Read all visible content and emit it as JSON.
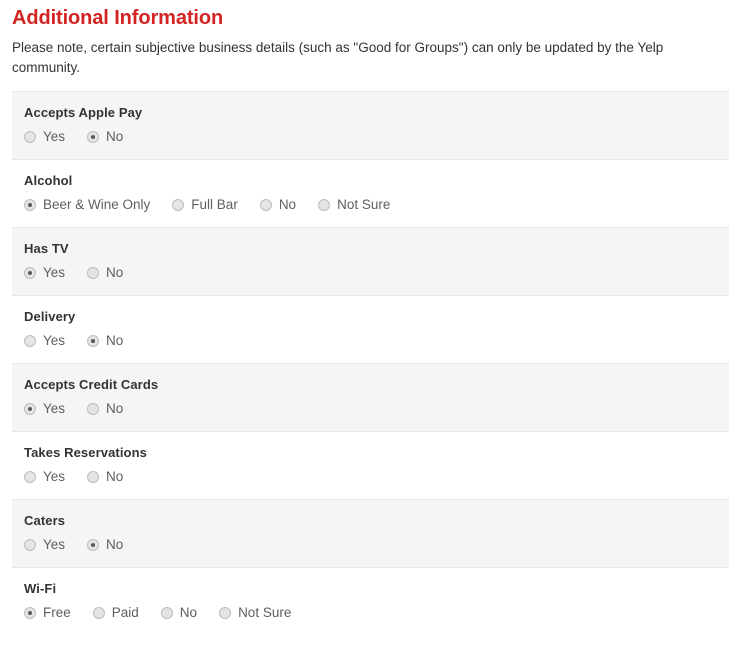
{
  "header": {
    "title": "Additional Information",
    "note": "Please note, certain subjective business details (such as \"Good for Groups\") can only be updated by the Yelp community."
  },
  "colors": {
    "title_red": "#d32323",
    "row_shaded": "#f5f5f5",
    "row_plain": "#ffffff",
    "divider": "#e6e6e6",
    "label_text": "#333333",
    "option_text": "#5f5f5f",
    "radio_fill": "#e4e4e4",
    "radio_dot": "#5a5a5a"
  },
  "attributes": [
    {
      "label": "Accepts Apple Pay",
      "shaded": true,
      "options": [
        {
          "label": "Yes",
          "selected": false
        },
        {
          "label": "No",
          "selected": true
        }
      ]
    },
    {
      "label": "Alcohol",
      "shaded": false,
      "options": [
        {
          "label": "Beer & Wine Only",
          "selected": true
        },
        {
          "label": "Full Bar",
          "selected": false
        },
        {
          "label": "No",
          "selected": false
        },
        {
          "label": "Not Sure",
          "selected": false
        }
      ]
    },
    {
      "label": "Has TV",
      "shaded": true,
      "options": [
        {
          "label": "Yes",
          "selected": true
        },
        {
          "label": "No",
          "selected": false
        }
      ]
    },
    {
      "label": "Delivery",
      "shaded": false,
      "options": [
        {
          "label": "Yes",
          "selected": false
        },
        {
          "label": "No",
          "selected": true
        }
      ]
    },
    {
      "label": "Accepts Credit Cards",
      "shaded": true,
      "options": [
        {
          "label": "Yes",
          "selected": true
        },
        {
          "label": "No",
          "selected": false
        }
      ]
    },
    {
      "label": "Takes Reservations",
      "shaded": false,
      "options": [
        {
          "label": "Yes",
          "selected": false
        },
        {
          "label": "No",
          "selected": false
        }
      ]
    },
    {
      "label": "Caters",
      "shaded": true,
      "options": [
        {
          "label": "Yes",
          "selected": false
        },
        {
          "label": "No",
          "selected": true
        }
      ]
    },
    {
      "label": "Wi-Fi",
      "shaded": false,
      "options": [
        {
          "label": "Free",
          "selected": true
        },
        {
          "label": "Paid",
          "selected": false
        },
        {
          "label": "No",
          "selected": false
        },
        {
          "label": "Not Sure",
          "selected": false
        }
      ]
    }
  ]
}
